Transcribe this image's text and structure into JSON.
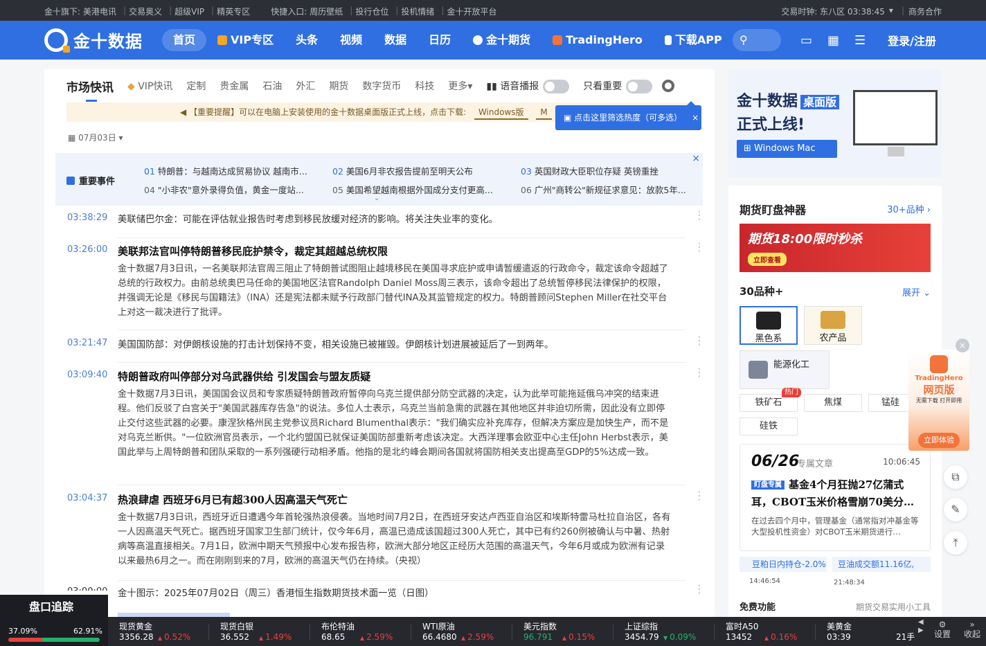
{
  "topbar": {
    "label": "金十旗下:",
    "links": [
      "美港电讯",
      "交易奥义",
      "超级VIP",
      "精英专区"
    ],
    "quick_label": "快捷入口:",
    "quick": [
      "周历壁纸",
      "投行仓位",
      "投机情绪",
      "金十开放平台"
    ],
    "clock": "交易时钟: 东八区 03:38:45",
    "biz": "商务合作"
  },
  "nav": {
    "logo": "金十数据",
    "items": [
      "首页",
      "VIP专区",
      "头条",
      "视频",
      "数据",
      "日历",
      "金十期货",
      "TradingHero",
      "下载APP"
    ],
    "login": "登录/注册"
  },
  "tabs": {
    "title": "市场快讯",
    "items": [
      "VIP快讯",
      "定制",
      "贵金属",
      "石油",
      "外汇",
      "期货",
      "数字货币",
      "科技",
      "更多"
    ],
    "voice": "语音播报",
    "important": "只看重要"
  },
  "notice": {
    "text": "【重要提醒】可以在电脑上安装使用的金十数据桌面版正式上线，点击下载:",
    "win": "Windows版",
    "mac": "M"
  },
  "tooltip": {
    "text": "点击这里筛选热度（可多选）"
  },
  "date": "07月03日",
  "events": {
    "label": "重要事件",
    "items": [
      {
        "n": "01",
        "t": "特朗普：与越南达成贸易协议 越南市..."
      },
      {
        "n": "02",
        "t": "美国6月非农报告提前至明天公布"
      },
      {
        "n": "03",
        "t": "英国财政大臣职位存疑 英镑重挫"
      },
      {
        "n": "04",
        "t": "\"小非农\"意外录得负值，黄金一度站..."
      },
      {
        "n": "05",
        "t": "美国希望越南根据外国成分支付更高..."
      },
      {
        "n": "06",
        "t": "广州\"商转公\"新规征求意见：放款5年..."
      }
    ]
  },
  "feed": [
    {
      "time": "03:38:29",
      "text": "美联储巴尔金：可能在评估就业报告时考虑到移民放缓对经济的影响。将关注失业率的变化。"
    },
    {
      "time": "03:26:00",
      "title": "美联邦法官叫停特朗普移民庇护禁令，裁定其超越总统权限",
      "body": "金十数据7月3日讯，一名美联邦法官周三阻止了特朗普试图阻止越境移民在美国寻求庇护或申请暂缓遣返的行政命令，裁定该命令超越了总统的行政权力。由前总统奥巴马任命的美国地区法官Randolph Daniel Moss周三表示，该命令超出了总统暂停移民法律保护的权限，并强调无论是《移民与国籍法》（INA）还是宪法都未赋予行政部门替代INA及其监管规定的权力。特朗普顾问Stephen Miller在社交平台上对这一裁决进行了批评。"
    },
    {
      "time": "03:21:47",
      "text": "美国国防部：对伊朗核设施的打击计划保持不变，相关设施已被摧毁。伊朗核计划进展被延后了一到两年。"
    },
    {
      "time": "03:09:40",
      "title": "特朗普政府叫停部分对乌武器供给 引发国会与盟友质疑",
      "body": "金十数据7月3日讯，美国国会议员和专家质疑特朗普政府暂停向乌克兰提供部分防空武器的决定，认为此举可能拖延俄乌冲突的结束进程。他们反驳了白宫关于\"美国武器库存告急\"的说法。多位人士表示，乌克兰当前急需的武器在其他地区并非迫切所需，因此没有立即停止交付这些武器的必要。康涅狄格州民主党参议员Richard Blumenthal表示：\"我们确实应补充库存，但解决方案应是加快生产，而不是对乌克兰断供。\"一位欧洲官员表示，一个北约盟国已就保证美国防部重新考虑该决定。大西洋理事会欧亚中心主任John Herbst表示，美国此举与上周特朗普和团队采取的一系列强硬行动相矛盾。他指的是北约峰会期间各国就将国防相关支出提高至GDP的5%达成一致。"
    },
    {
      "time": "03:04:37",
      "title": "热浪肆虐 西班牙6月已有超300人因高温天气死亡",
      "body": "金十数据7月3日讯，西班牙近日遭遇今年首轮强热浪侵袭。当地时间7月2日，在西班牙安达卢西亚自治区和埃斯特雷马杜拉自治区，各有一人因高温天气死亡。据西班牙国家卫生部门统计，仅今年6月，高温已造成该国超过300人死亡，其中已有约260例被确认与中暑、热射病等高温直接相关。7月1日，欧洲中期天气预报中心发布报告称，欧洲大部分地区正经历大范围的高温天气，今年6月或成为欧洲有记录以来最热6月之一。而在刚刚到来的7月，欧洲的高温天气仍在持续。（央视）"
    },
    {
      "time": "03:00:00",
      "text": "金十图示：2025年07月02日（周三）香港恒生指数期货技术面一览（日图）"
    }
  ],
  "promo": {
    "line1": "金十数据",
    "tag": "桌面版",
    "line2": "正式上线!",
    "btns": "Windows  Mac"
  },
  "futures": {
    "title": "期货盯盘神器",
    "more": "30+品种",
    "banner": "期货18:00限时秒杀",
    "banner_cta": "立即查看",
    "count_title": "30品种+",
    "expand": "展开",
    "cats": [
      "黑色系",
      "农产品",
      "能源化工"
    ],
    "chips": [
      "铁矿石",
      "焦煤",
      "锰硅",
      "硅铁"
    ],
    "hot": "热门"
  },
  "article": {
    "date": "06/26",
    "kind": "专属文章",
    "time": "10:06:45",
    "tag": "盯盘专属",
    "title": "基金4个月狂抛27亿蒲式耳，CBOT玉米价格雪崩70美分…",
    "desc": "在过去四个月中，管理基金（通常指对冲基金等大型投机性资金）对CBOT玉米期货进行…"
  },
  "ticks": {
    "a": "豆粕日内持仓-2.0%",
    "b": "豆油成交额11.16亿,",
    "ta": "14:46:54",
    "tb": "21:48:34"
  },
  "free": {
    "title": "免费功能",
    "desc": "期货交易实用小工具"
  },
  "float": {
    "brand": "TradingHero",
    "title": "网页版",
    "sub": "无需下载 打开即用",
    "btn": "立即体验"
  },
  "track": {
    "title": "盘口追踪",
    "a": "37.09%",
    "b": "62.91%"
  },
  "ticker": [
    {
      "name": "现货黄金",
      "value": "3356.28",
      "change": "0.52%",
      "dir": "up"
    },
    {
      "name": "现货白银",
      "value": "36.552",
      "change": "1.49%",
      "dir": "up"
    },
    {
      "name": "布伦特油",
      "value": "68.65",
      "change": "2.59%",
      "dir": "up"
    },
    {
      "name": "WTI原油",
      "value": "66.4680",
      "change": "2.59%",
      "dir": "up"
    },
    {
      "name": "美元指数",
      "value": "96.791",
      "change": "0.15%",
      "dir": "up"
    },
    {
      "name": "上证综指",
      "value": "3454.79",
      "change": "0.09%",
      "dir": "dn"
    },
    {
      "name": "富时A50",
      "value": "13452",
      "change": "0.16%",
      "dir": "up"
    },
    {
      "name": "美黄金",
      "value": "03:39",
      "change": "",
      "dir": ""
    }
  ],
  "ticker_end": "21手",
  "ticker_settings": "设置",
  "ticker_collapse": "收起"
}
